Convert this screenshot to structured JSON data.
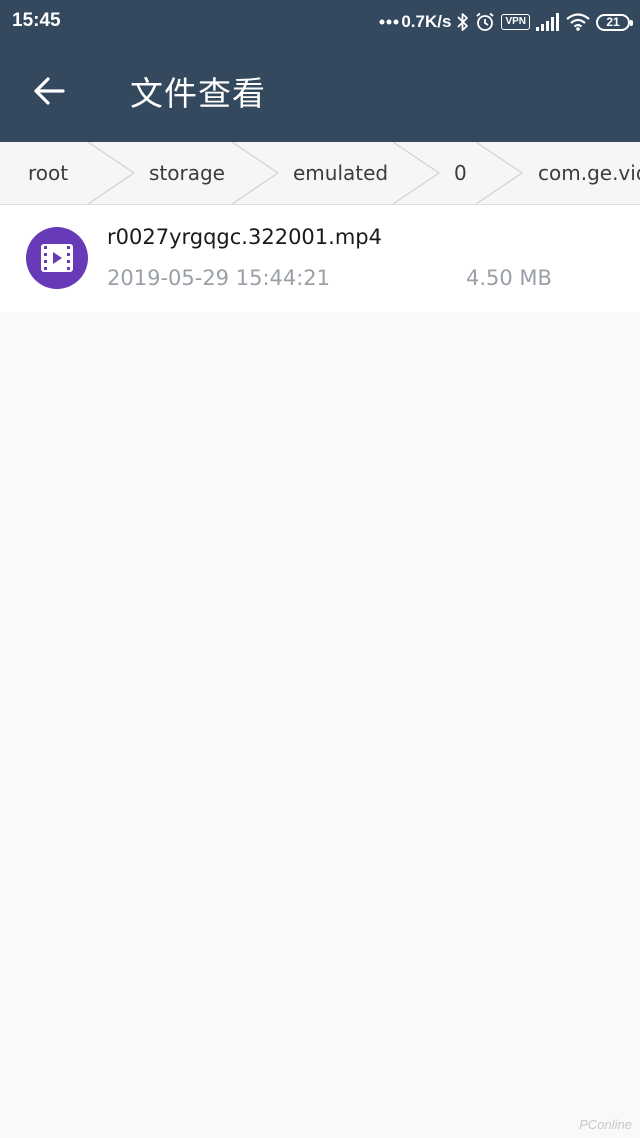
{
  "status_bar": {
    "time": "15:45",
    "network_speed": "0.7K/s",
    "vpn_label": "VPN",
    "battery_level": "21",
    "icons": [
      "more-dots-icon",
      "bluetooth-icon",
      "alarm-icon",
      "vpn-icon",
      "signal-icon",
      "wifi-icon",
      "battery-icon"
    ]
  },
  "app_bar": {
    "title": "文件查看",
    "back_icon": "arrow-left-icon"
  },
  "breadcrumb": {
    "items": [
      "root",
      "storage",
      "emulated",
      "0",
      "com.ge.vid"
    ]
  },
  "files": [
    {
      "icon": "video-file-icon",
      "name": "r0027yrgqgc.322001.mp4",
      "date": "2019-05-29 15:44:21",
      "size": "4.50 MB"
    }
  ],
  "watermark": "PConline",
  "colors": {
    "app_bar": "#34495e",
    "video_icon_bg": "#673ab7",
    "background": "#f9f9f9",
    "secondary_text": "#9aa0a8"
  }
}
